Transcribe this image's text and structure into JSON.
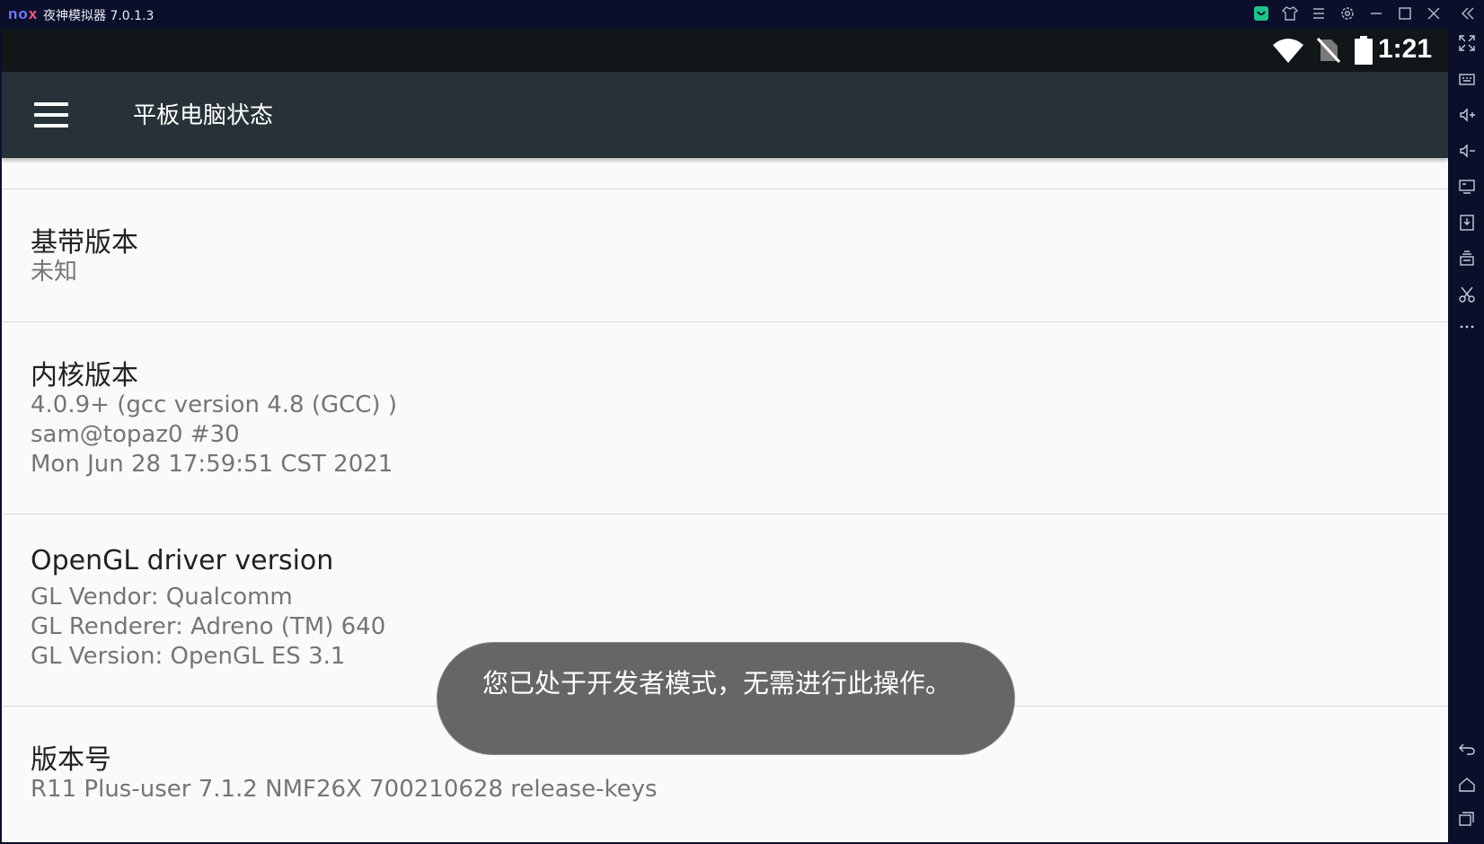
{
  "window": {
    "logo": "nox",
    "title": "夜神模拟器 7.0.1.3",
    "controls": [
      "app-store-icon",
      "skin-icon",
      "menu-icon",
      "settings-icon",
      "minimize-icon",
      "maximize-icon",
      "close-icon",
      "collapse-icon"
    ]
  },
  "statusbar": {
    "time": "1:21"
  },
  "appbar": {
    "title": "平板电脑状态"
  },
  "rows": [
    {
      "label": "基带版本",
      "summary": "未知"
    },
    {
      "label": "内核版本",
      "summary": "4.0.9+ (gcc version 4.8 (GCC) )\nsam@topaz0 #30\nMon Jun 28 17:59:51 CST 2021"
    },
    {
      "label": "OpenGL driver version",
      "summary": "GL Vendor: Qualcomm\nGL Renderer: Adreno (TM) 640\nGL Version: OpenGL ES 3.1"
    },
    {
      "label": "版本号",
      "summary": "R11 Plus-user 7.1.2 NMF26X 700210628 release-keys"
    }
  ],
  "toast": {
    "message": "您已处于开发者模式，无需进行此操作。"
  },
  "colors": {
    "appbar": "#263238",
    "statusbar": "#111618",
    "frame": "#0b0f2a",
    "toast": "#666666"
  }
}
